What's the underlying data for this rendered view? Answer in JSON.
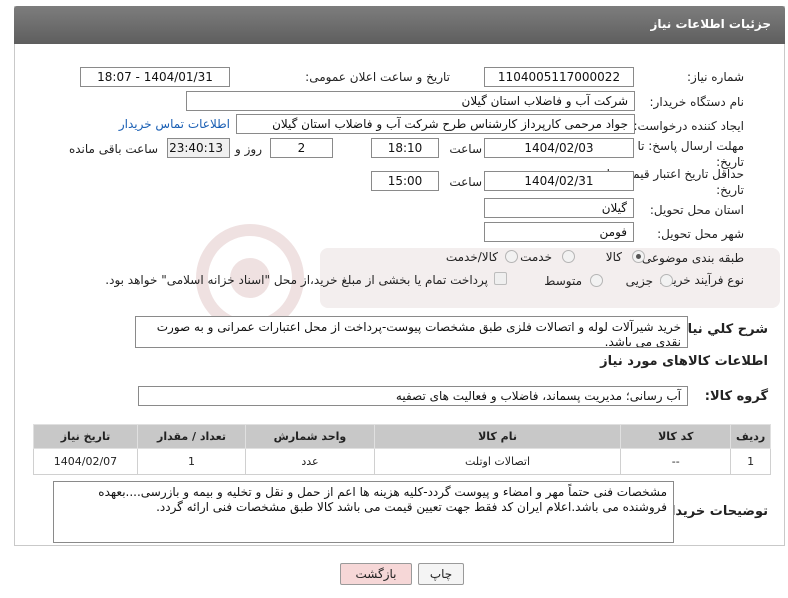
{
  "header": {
    "title": "جزئیات اطلاعات نیاز"
  },
  "form": {
    "need_number_label": "شماره نیاز:",
    "need_number": "1104005117000022",
    "announce_label": "تاریخ و ساعت اعلان عمومی:",
    "announce_value": "1404/01/31 - 18:07",
    "buyer_org_label": "نام دستگاه خریدار:",
    "buyer_org": "شرکت آب و فاضلاب استان گیلان",
    "creator_label": "ایجاد کننده درخواست:",
    "creator": "جواد مرحمی کارپرداز کارشناس طرح شرکت آب و فاضلاب استان گیلان",
    "buyer_contact_link": "اطلاعات تماس خریدار",
    "deadline_label": "مهلت ارسال پاسخ: تا تاریخ:",
    "deadline_date": "1404/02/03",
    "time_label": "ساعت",
    "deadline_time": "18:10",
    "days_value": "2",
    "days_label": "روز و",
    "remaining_time": "23:40:13",
    "remaining_label": "ساعت باقی مانده",
    "validity_label": "حداقل تاریخ اعتبار قیمت: تا تاریخ:",
    "validity_date": "1404/02/31",
    "validity_time_label": "ساعت",
    "validity_time": "15:00",
    "province_label": "استان محل تحویل:",
    "province": "گیلان",
    "city_label": "شهر محل تحویل:",
    "city": "فومن",
    "category_label": "طبقه بندی موضوعی:",
    "category_options": [
      "کالا",
      "خدمت",
      "کالا/خدمت"
    ],
    "process_label": "نوع فرآیند خرید :",
    "process_options": [
      "جزیی",
      "متوسط"
    ],
    "payment_note": "پرداخت تمام یا بخشی از مبلغ خرید،از محل \"اسناد خزانه اسلامی\" خواهد بود.",
    "summary_label": "شرح كلي نياز:",
    "summary": "خرید شیرآلات لوله و اتصالات فلزی طبق مشخصات پیوست-پرداخت از محل اعتبارات عمرانی و به صورت نقدی می باشد.",
    "goods_info_title": "اطلاعات کالاهای مورد نیاز",
    "goods_group_label": "گروه کالا:",
    "goods_group": "آب رسانی؛ مدیریت پسماند، فاضلاب و فعالیت های تصفیه"
  },
  "table": {
    "headers": [
      "ردیف",
      "کد کالا",
      "نام کالا",
      "واحد شمارش",
      "تعداد / مقدار",
      "تاریخ نیاز"
    ],
    "rows": [
      [
        "1",
        "--",
        "اتصالات اوتلت",
        "عدد",
        "1",
        "1404/02/07"
      ]
    ]
  },
  "buyer_notes_label": "توضیحات خریدار:",
  "buyer_notes": "مشخصات فنی حتماً مهر و امضاء و پیوست گردد-کلیه هزینه ها اعم از حمل و نقل و تخلیه و بیمه و بازرسی....بعهده فروشنده می باشد.اعلام ایران کد فقط جهت تعیین قیمت می باشد کالا طبق مشخصات فنی ارائه گردد.",
  "buttons": {
    "print": "چاپ",
    "back": "بازگشت"
  },
  "colors": {
    "header_bg": "#6b6b6b",
    "link": "#1a5fb4",
    "back_button_bg": "#f6d7d7",
    "table_header_bg": "#c8c8c8"
  }
}
